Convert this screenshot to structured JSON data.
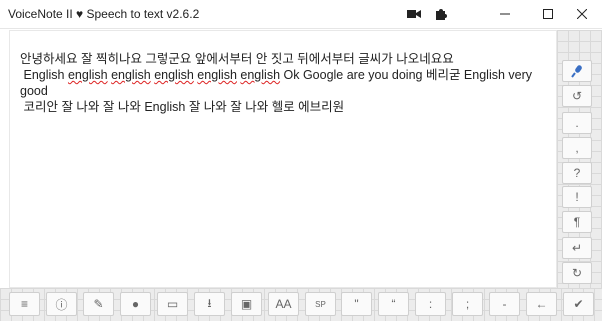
{
  "window": {
    "title": "VoiceNote II ♥ Speech to text v2.6.2"
  },
  "titlebar_icons": [
    "camera-icon",
    "puzzle-icon",
    "minimize-icon",
    "maximize-icon",
    "close-icon"
  ],
  "text": {
    "line1": "안녕하세요 잘 찍히나요 그렇군요 앞에서부터 안 짓고 뒤에서부터 글씨가 나오네요요",
    "line2_prefix": " English ",
    "line2_words": [
      "english",
      "english",
      "english",
      "english",
      "english"
    ],
    "line2_suffix": " Ok Google are you doing 베리굳 English very good",
    "line3": " 코리안 잘 나와 잘 나와 English 잘 나와 잘 나와 헬로 에브리원"
  },
  "sidebar": {
    "buttons": [
      {
        "name": "microphone-button",
        "label": "",
        "icon": "microphone-icon",
        "color": "#3a6fc4"
      },
      {
        "name": "undo-button",
        "label": "↺",
        "icon": "undo-icon"
      },
      {
        "name": "period-button",
        "label": "."
      },
      {
        "name": "comma-button",
        "label": ","
      },
      {
        "name": "question-button",
        "label": "?"
      },
      {
        "name": "exclamation-button",
        "label": "!"
      },
      {
        "name": "paragraph-button",
        "label": "¶"
      },
      {
        "name": "newline-button",
        "label": "↵",
        "icon": "return-icon"
      },
      {
        "name": "redo-button",
        "label": "↻",
        "icon": "redo-icon"
      }
    ]
  },
  "bottombar": {
    "buttons": [
      {
        "name": "menu-button",
        "label": "≡",
        "icon": "menu-icon"
      },
      {
        "name": "info-button",
        "label": "ⓘ",
        "icon": "info-icon"
      },
      {
        "name": "pencil-button",
        "label": "✎",
        "icon": "pencil-icon"
      },
      {
        "name": "globe-button",
        "label": "●",
        "icon": "globe-icon"
      },
      {
        "name": "eraser-button",
        "label": "▭",
        "icon": "eraser-icon"
      },
      {
        "name": "download-button",
        "label": "⭳",
        "icon": "download-icon"
      },
      {
        "name": "save-button",
        "label": "▣",
        "icon": "save-icon"
      },
      {
        "name": "font-size-button",
        "label": "AA"
      },
      {
        "name": "space-button",
        "label": "SP"
      },
      {
        "name": "double-quote-button",
        "label": "\""
      },
      {
        "name": "single-quote-button",
        "label": "“"
      },
      {
        "name": "colon-button",
        "label": ":"
      },
      {
        "name": "semicolon-button",
        "label": ";"
      },
      {
        "name": "dash-button",
        "label": "-"
      },
      {
        "name": "backspace-button",
        "label": "←",
        "icon": "backspace-icon"
      },
      {
        "name": "confirm-button",
        "label": "✔",
        "icon": "check-icon"
      }
    ]
  }
}
